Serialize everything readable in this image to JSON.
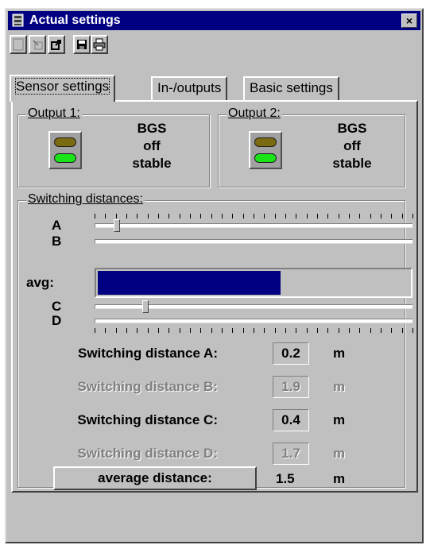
{
  "window": {
    "title": "Actual settings",
    "close_glyph": "×",
    "icon": "database-icon"
  },
  "toolbar": {
    "buttons": [
      "new-icon",
      "import-icon",
      "export-icon",
      "save-icon",
      "print-icon"
    ]
  },
  "tabs": [
    {
      "label": "Sensor settings",
      "active": true
    },
    {
      "label": "In-/outputs",
      "active": false
    },
    {
      "label": "Basic settings",
      "active": false
    }
  ],
  "outputs": [
    {
      "label": "Output 1:",
      "type": "BGS",
      "state": "off",
      "stability": "stable"
    },
    {
      "label": "Output 2:",
      "type": "BGS",
      "state": "off",
      "stability": "stable"
    }
  ],
  "switching": {
    "group_label": "Switching distances:",
    "sliders": {
      "A": "A",
      "B": "B",
      "avg": "avg:",
      "C": "C",
      "D": "D"
    },
    "slider_positions": {
      "A": 0.07,
      "C": 0.16
    },
    "avg_fill_fraction": 0.58,
    "rows": [
      {
        "label": "Switching distance A:",
        "value": "0.2",
        "unit": "m",
        "enabled": true
      },
      {
        "label": "Switching distance B:",
        "value": "1.9",
        "unit": "m",
        "enabled": false
      },
      {
        "label": "Switching distance C:",
        "value": "0.4",
        "unit": "m",
        "enabled": true
      },
      {
        "label": "Switching distance D:",
        "value": "1.7",
        "unit": "m",
        "enabled": false
      }
    ],
    "average": {
      "button_label": "average distance:",
      "value": "1.5",
      "unit": "m"
    }
  },
  "colors": {
    "titlebar": "#000080",
    "led_off": "#7a6a10",
    "led_on": "#18e418",
    "avg_bar": "#000080"
  }
}
